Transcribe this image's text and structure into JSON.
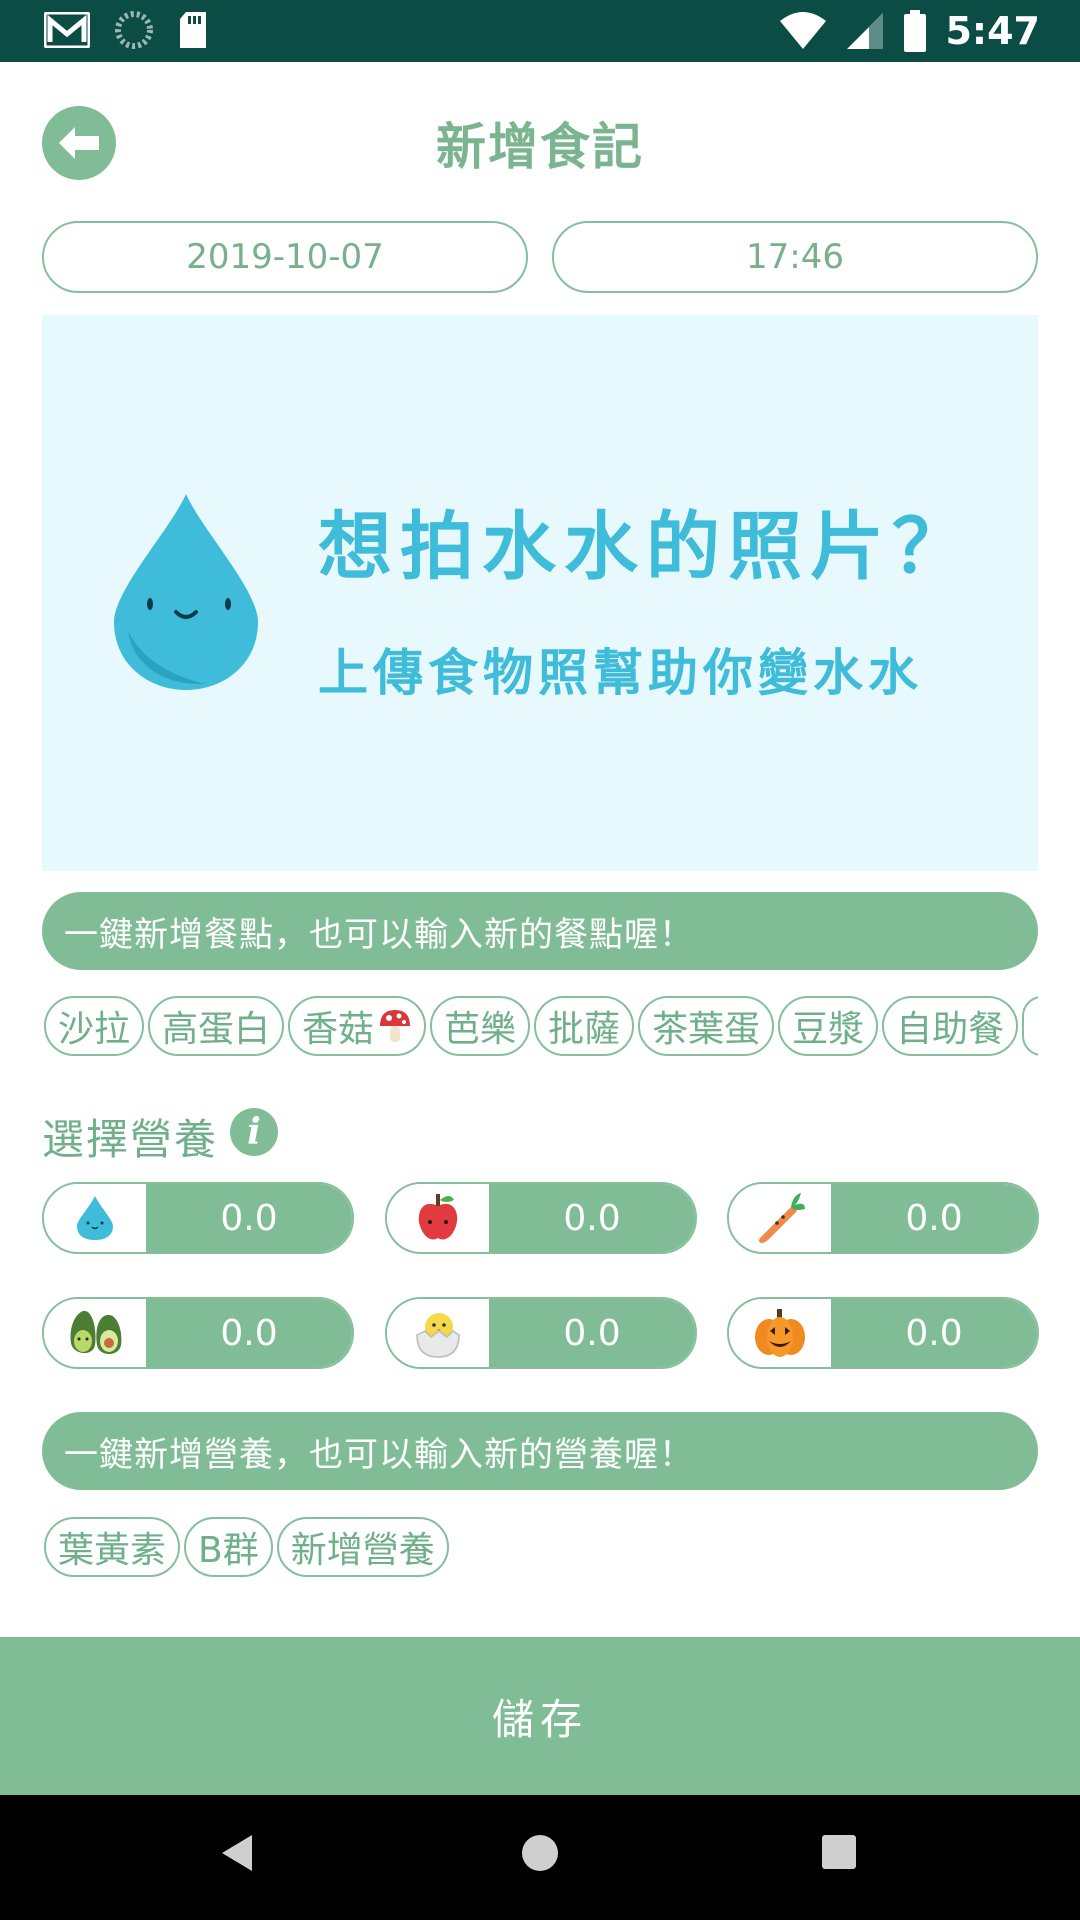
{
  "status_bar": {
    "time": "5:47"
  },
  "header": {
    "title": "新增食記"
  },
  "date_time": {
    "date": "2019-10-07",
    "time": "17:46"
  },
  "upload": {
    "title": "想拍水水的照片？",
    "subtitle": "上傳食物照幫助你變水水"
  },
  "meal": {
    "hint": "一鍵新增餐點，也可以輸入新的餐點喔！",
    "tags": [
      "沙拉",
      "高蛋白",
      "香菇",
      "芭樂",
      "批薩",
      "茶葉蛋",
      "豆漿",
      "自助餐"
    ]
  },
  "nutrition": {
    "label": "選擇營養",
    "items": [
      {
        "icon": "water-drop-icon",
        "value": "0.0"
      },
      {
        "icon": "apple-icon",
        "value": "0.0"
      },
      {
        "icon": "carrot-icon",
        "value": "0.0"
      },
      {
        "icon": "avocado-icon",
        "value": "0.0"
      },
      {
        "icon": "chick-egg-icon",
        "value": "0.0"
      },
      {
        "icon": "pumpkin-icon",
        "value": "0.0"
      }
    ],
    "hint": "一鍵新增營養，也可以輸入新的營養喔！",
    "tags": [
      "葉黃素",
      "B群",
      "新增營養"
    ]
  },
  "save": {
    "label": "儲存"
  },
  "colors": {
    "accent": "#80bd97",
    "status_bar": "#0b4d45",
    "upload_bg": "#e7f9fc",
    "upload_text": "#3fbcd9"
  }
}
